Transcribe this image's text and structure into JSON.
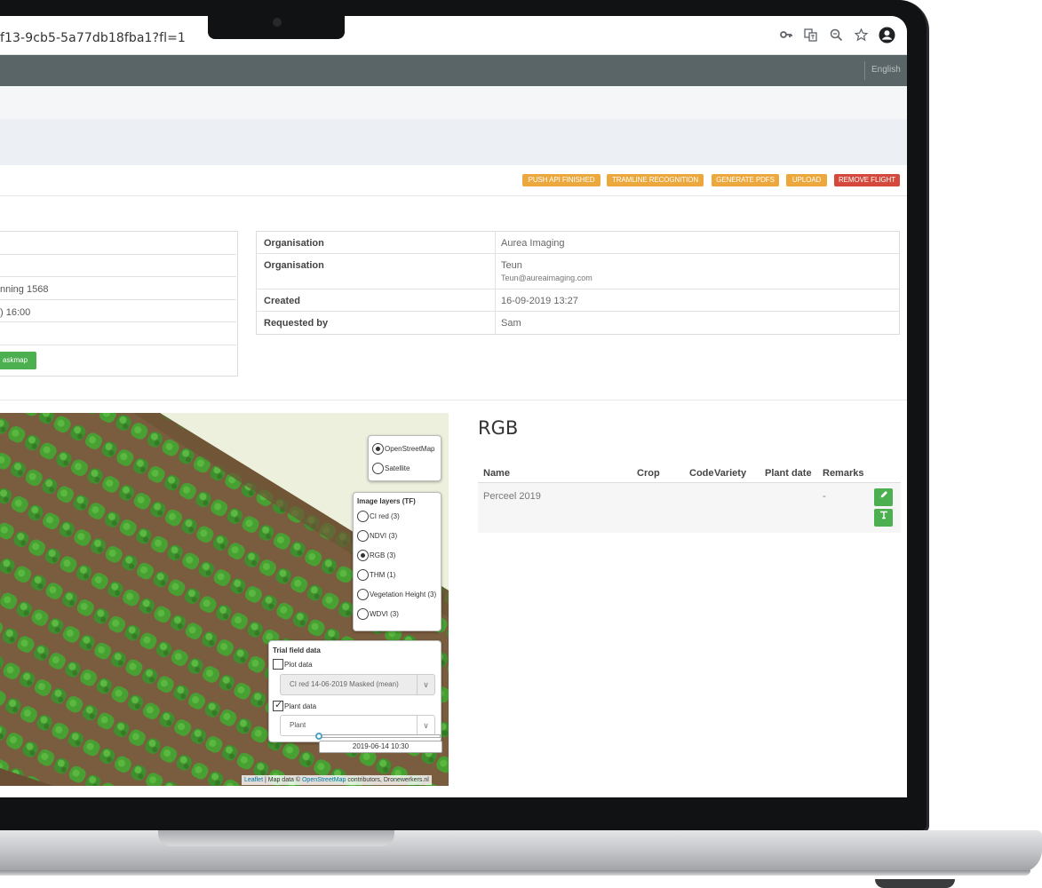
{
  "browser": {
    "url": "f13-9cb5-5a77db18fba1?fl=1",
    "icons": [
      "key-icon",
      "translate-icon",
      "zoom-icon",
      "star-icon",
      "account-icon"
    ]
  },
  "topnav": {
    "language": "English"
  },
  "actions": {
    "push_api": "PUSH API FINISHED",
    "tramline": "TRAMLINE RECOGNITION",
    "generate_pdfs": "GENERATE PDFS",
    "upload": "UPLOAD",
    "remove_flight": "REMOVE FLIGHT",
    "colors": {
      "orange": "#eca83c",
      "red": "#d4493c"
    }
  },
  "left_info": {
    "rows": [
      "",
      "",
      "nning 1568",
      ") 16:00",
      ""
    ],
    "taskmap_button": "askmap"
  },
  "info": {
    "org1_key": "Organisation",
    "org1_val": "Aurea Imaging",
    "org2_key": "Organisation",
    "org2_val": "Teun",
    "org2_email": "Teun@aureaimaging.com",
    "created_key": "Created",
    "created_val": "16-09-2019 13:27",
    "requested_key": "Requested by",
    "requested_val": "Sam"
  },
  "map": {
    "base_layers": [
      {
        "label": "OpenStreetMap",
        "selected": true
      },
      {
        "label": "Satellite",
        "selected": false
      }
    ],
    "image_layers_title": "Image layers (TF)",
    "image_layers": [
      {
        "label": "CI red (3)",
        "selected": false
      },
      {
        "label": "NDVI (3)",
        "selected": false
      },
      {
        "label": "RGB (3)",
        "selected": true
      },
      {
        "label": "THM (1)",
        "selected": false
      },
      {
        "label": "Vegetation Height (3)",
        "selected": false
      },
      {
        "label": "WDVI (3)",
        "selected": false
      }
    ],
    "trial_title": "Trial field data",
    "plot_data_label": "Plot data",
    "plot_data_checked": false,
    "plot_select": "CI red 14-06-2019 Masked (mean)",
    "plant_data_label": "Plant data",
    "plant_data_checked": true,
    "plant_select": "Plant",
    "slider_date": "2019-06-14 10:30",
    "attribution_leaflet": "Leaflet",
    "attribution_mid": " | Map data © ",
    "attribution_osm": "OpenStreetMap",
    "attribution_tail": " contributors, Dronewerkers.nl"
  },
  "rgb": {
    "title": "RGB",
    "columns": {
      "name": "Name",
      "crop": "Crop",
      "code": "Code",
      "variety": "Variety",
      "plant_date": "Plant date",
      "remarks": "Remarks"
    },
    "rows": [
      {
        "name": "Perceel 2019",
        "remarks": "-"
      }
    ]
  }
}
